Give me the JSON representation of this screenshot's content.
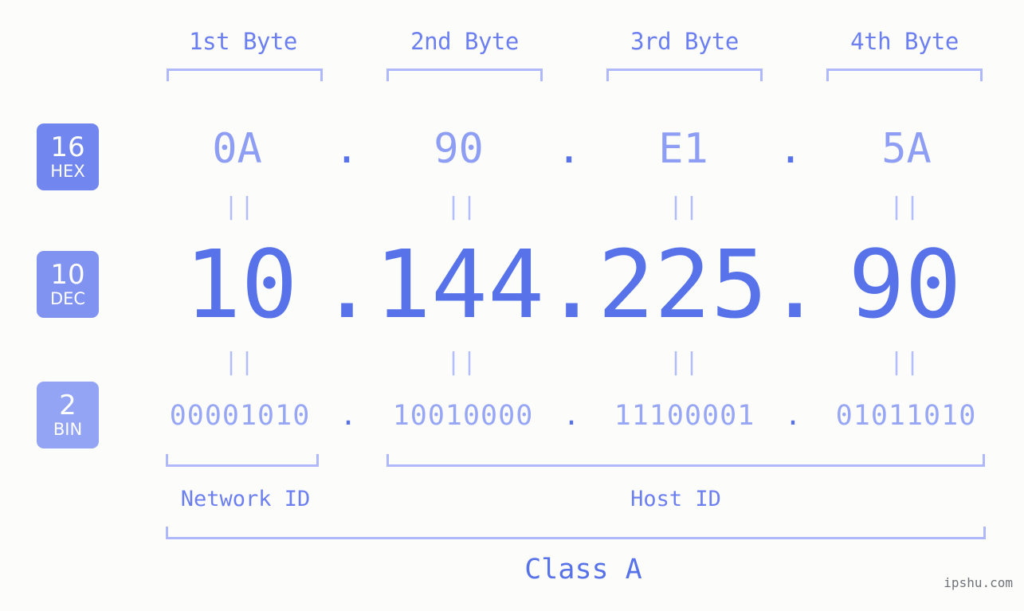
{
  "page": {
    "background_color": "#fcfdfa",
    "accent_dark": "#5873ea",
    "accent_mid": "#6c7ff0",
    "accent_light": "#8e9ef4",
    "bracket_color": "#aeb8fb",
    "watermark": "ipshu.com"
  },
  "headers": [
    {
      "label": "1st Byte"
    },
    {
      "label": "2nd Byte"
    },
    {
      "label": "3rd Byte"
    },
    {
      "label": "4th Byte"
    }
  ],
  "rows": {
    "hex": {
      "badge_number": "16",
      "badge_abbr": "HEX",
      "badge_color": "#7186ef",
      "values": [
        "0A",
        "90",
        "E1",
        "5A"
      ],
      "separator": "."
    },
    "dec": {
      "badge_number": "10",
      "badge_abbr": "DEC",
      "badge_color": "#8093f1",
      "values": [
        "10",
        "144",
        "225",
        "90"
      ],
      "separator": "."
    },
    "bin": {
      "badge_number": "2",
      "badge_abbr": "BIN",
      "badge_color": "#93a4f4",
      "values": [
        "00001010",
        "10010000",
        "11100001",
        "01011010"
      ],
      "separator": "."
    }
  },
  "equals_marks": {
    "glyph": "||",
    "count_per_row": 4
  },
  "segments": {
    "network_id": "Network ID",
    "host_id": "Host ID",
    "class": "Class A"
  },
  "chart_data": {
    "type": "table",
    "title": "IPv4 Address Byte Breakdown — 10.144.225.90 (Class A)",
    "columns": [
      "1st Byte",
      "2nd Byte",
      "3rd Byte",
      "4th Byte"
    ],
    "rows": [
      {
        "radix": "16",
        "name": "HEX",
        "values": [
          "0A",
          "90",
          "E1",
          "5A"
        ]
      },
      {
        "radix": "10",
        "name": "DEC",
        "values": [
          "10",
          "144",
          "225",
          "90"
        ]
      },
      {
        "radix": "2",
        "name": "BIN",
        "values": [
          "00001010",
          "10010000",
          "11100001",
          "01011010"
        ]
      }
    ],
    "annotations": {
      "network_id_bytes": [
        "1st Byte"
      ],
      "host_id_bytes": [
        "2nd Byte",
        "3rd Byte",
        "4th Byte"
      ],
      "class": "Class A"
    }
  }
}
